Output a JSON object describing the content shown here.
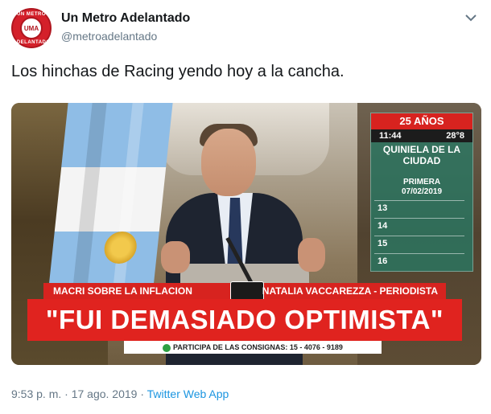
{
  "tweet": {
    "author_name": "Un Metro Adelantado",
    "author_handle": "@metroadelantado",
    "avatar_text": "UMA",
    "avatar_ring_top": "UN METRO",
    "avatar_ring_bottom": "ADELANTADO",
    "text": "Los hinchas de Racing yendo hoy a la cancha.",
    "time": "9:53 p. m. · 17 ago. 2019 · ",
    "source": "Twitter Web App",
    "more_icon": "chevron-down-icon"
  },
  "media": {
    "tv_box": {
      "years": "25 AÑOS",
      "time": "11:44",
      "temp": "28°8",
      "title": "QUINIELA DE LA CIUDAD",
      "subtitle1": "PRIMERA",
      "subtitle2": "07/02/2019",
      "numbers": [
        "13",
        "14",
        "15",
        "16"
      ]
    },
    "lower_third": {
      "left": "MACRI SOBRE LA INFLACION",
      "right": "NATALIA VACCAREZZA - PERIODISTA",
      "headline": "\"FUI DEMASIADO OPTIMISTA\"",
      "footer": "PARTICIPA DE LAS CONSIGNAS: 15 - 4076 - 9189"
    }
  }
}
